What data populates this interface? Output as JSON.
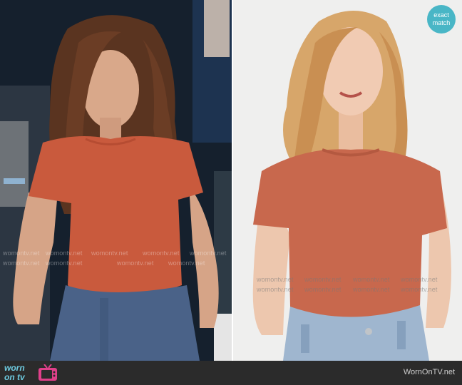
{
  "watermarks": {
    "left_row1": "womontv.net",
    "left_row2": "womontv.net",
    "right_row1": "womontv.net",
    "right_row2": "womontv.net"
  },
  "badge": {
    "line1": "exact",
    "line2": "match"
  },
  "footer": {
    "logo_top": "worn",
    "logo_bottom": "on tv",
    "credit": "WornOnTV.net"
  },
  "colors": {
    "left_bg": "#142231",
    "tee": "#c95a3d",
    "tee_right": "#c8684d",
    "denim": "#4a6288",
    "denim_right": "#9fb6cf",
    "badge": "#49b6c6",
    "footer_bg": "#2b2b2b"
  },
  "icons": [
    "tv-icon"
  ]
}
